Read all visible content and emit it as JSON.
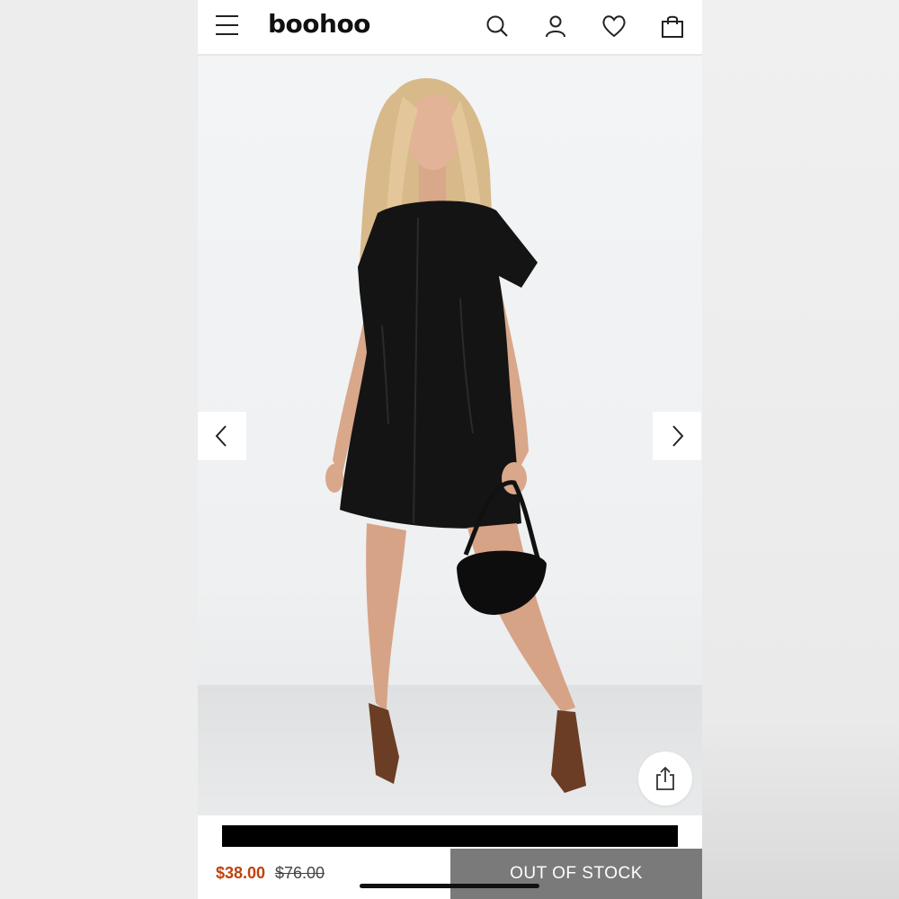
{
  "header": {
    "logo": "boohoo",
    "icons": [
      "menu-icon",
      "search-icon",
      "account-icon",
      "heart-icon",
      "bag-icon"
    ]
  },
  "gallery": {
    "prev_icon": "chevron-left-icon",
    "next_icon": "chevron-right-icon",
    "share_icon": "share-icon"
  },
  "product": {
    "price_now": "$38.00",
    "price_was": "$76.00",
    "stock_button": "OUT OF STOCK"
  },
  "colors": {
    "price_accent": "#c2410c",
    "oos_button": "#7a7a7a",
    "name_redaction": "#000000"
  }
}
